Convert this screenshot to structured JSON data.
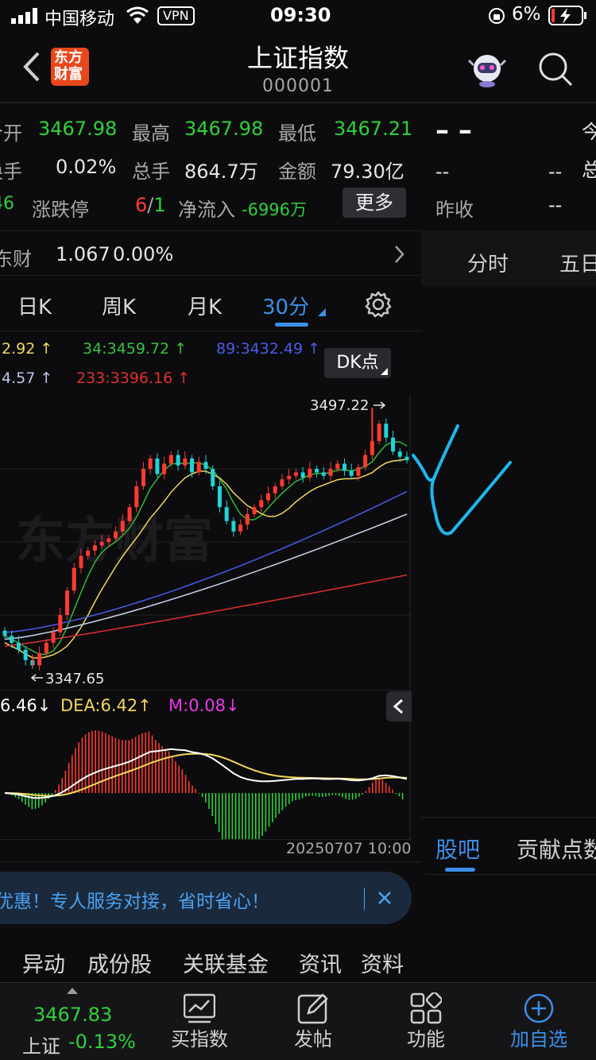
{
  "status_bar": {
    "carrier": "中国移动",
    "vpn": "VPN",
    "time": "09:30",
    "battery": "6%"
  },
  "header": {
    "logo_text_1": "东方",
    "logo_text_2": "财富",
    "title": "上证指数",
    "code": "000001"
  },
  "quote": {
    "open_label": "今开",
    "open_value": "3467.98",
    "high_label": "最高",
    "high_value": "3467.98",
    "low_label": "最低",
    "low_value": "3467.21",
    "turnover_label": "换手",
    "turnover_value": "0.02%",
    "volume_label": "总手",
    "volume_value": "864.7万",
    "amount_label": "金额",
    "amount_value": "79.30亿",
    "limit_left": "46",
    "limit_label": "涨跌停",
    "limit_up": "6",
    "limit_sep": "/",
    "limit_down": "1",
    "netflow_label": "净流入",
    "netflow_value": "-6996万",
    "more_label": "更多",
    "related_label": "东财",
    "related_price": "1.067",
    "related_change": "0.00%"
  },
  "right_panel": {
    "dash_big": "– –",
    "row2_a": "--",
    "row2_b": "--",
    "prev_close_label": "昨收",
    "prev_close_value": "--",
    "cut_label_1": "今",
    "cut_label_2": "总",
    "tab_time": "分时",
    "tab_five": "五日",
    "tab_guba": "股吧",
    "tab_contrib": "贡献点数"
  },
  "period_tabs": {
    "day": "日K",
    "week": "周K",
    "month": "月K",
    "min30": "30分"
  },
  "ma": {
    "ma_a": "2.92",
    "ma34": "34:3459.72",
    "ma89": "89:3432.49",
    "ma_b": "4.57",
    "ma233": "233:3396.16",
    "dk_label": "DK点"
  },
  "chart_labels": {
    "high_marker": "3497.22",
    "low_marker": "3347.65",
    "watermark": "东方财富"
  },
  "macd": {
    "dif": "6.46",
    "dea": "DEA:6.42",
    "m": "M:0.08",
    "date": "20250707 10:00"
  },
  "banner": {
    "text": "优惠！专人服务对接，省时省心！"
  },
  "bottom_tabs": [
    "异动",
    "成份股",
    "关联基金",
    "资讯",
    "资料"
  ],
  "bottom_nav": {
    "index_price": "3467.83",
    "index_name": "上证",
    "index_change": "-0.13%",
    "buy_label": "买指数",
    "post_label": "发帖",
    "func_label": "功能",
    "add_label": "加自选"
  },
  "colors": {
    "up": "#ff3b30",
    "down": "#2fd13a",
    "accent": "#3c8fe8",
    "annotation": "#1fb7ee"
  },
  "chart_data": {
    "type": "candlestick",
    "title": "",
    "ylim": [
      3335,
      3505
    ],
    "series": [
      {
        "name": "30分K",
        "close": [
          3366,
          3362,
          3358,
          3352,
          3349,
          3356,
          3362,
          3368,
          3378,
          3392,
          3405,
          3412,
          3415,
          3418,
          3420,
          3422,
          3426,
          3432,
          3440,
          3452,
          3462,
          3468,
          3459,
          3465,
          3470,
          3464,
          3468,
          3460,
          3466,
          3462,
          3452,
          3440,
          3432,
          3426,
          3430,
          3436,
          3440,
          3444,
          3448,
          3452,
          3456,
          3458,
          3460,
          3457,
          3462,
          3460,
          3458,
          3462,
          3465,
          3461,
          3458,
          3463,
          3470,
          3478,
          3488,
          3480,
          3472,
          3469,
          3467
        ],
        "high_point": 3497.22,
        "low_point": 3347.65
      }
    ]
  }
}
